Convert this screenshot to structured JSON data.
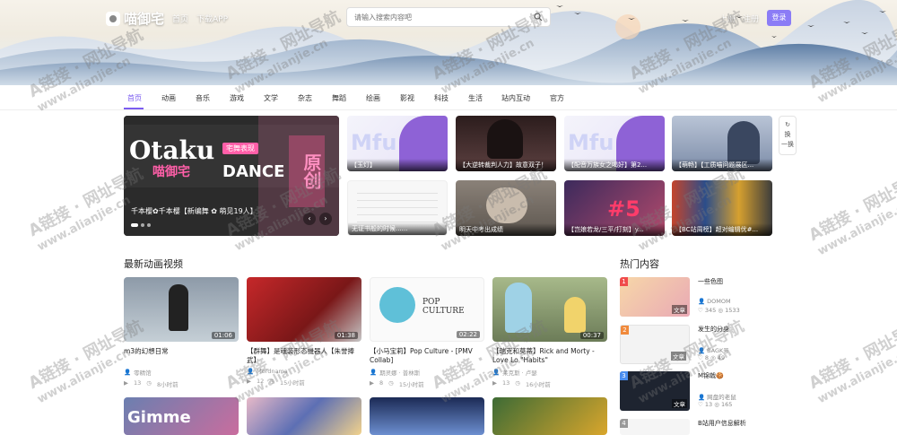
{
  "header": {
    "logo": "喵御宅",
    "nav": [
      "首页",
      "下载APP"
    ],
    "search_placeholder": "请输入搜索内容吧",
    "register": "上册",
    "sign_up": "注册",
    "login": "登录"
  },
  "categories": [
    "首页",
    "动画",
    "音乐",
    "游戏",
    "文学",
    "杂志",
    "舞蹈",
    "绘画",
    "影视",
    "科技",
    "生活",
    "站内互动",
    "官方"
  ],
  "active_category": "首页",
  "hero": {
    "t1": "Otaku",
    "t2": "喵御宅",
    "t3": "DANCE",
    "t4": "原创",
    "tag": "宅舞表现",
    "caption": "千本樱✿千本樱【新编舞 ✿ 萌见19人】"
  },
  "featured": [
    {
      "caption": "【玉灯】",
      "mfu": "Mfu"
    },
    {
      "caption": "【大逆转裁判人力】故意双子！"
    },
    {
      "caption": "【配音万族女之喝好】第2...",
      "mfu": "Mfu"
    },
    {
      "caption": "【萌畅】【工质喵问题展区..."
    },
    {
      "caption": "无证书般的时候......"
    },
    {
      "caption": "明天中考出成绩"
    },
    {
      "caption": "【岂娘若龙/三平/打刻】y...",
      "big": "#5"
    },
    {
      "caption": "【BC站周榜】超对编辑优#..."
    }
  ],
  "refresh": {
    "top": "换",
    "bottom": "一换"
  },
  "sections": {
    "latest": "最新动画视频",
    "hot": "热门内容"
  },
  "videos": [
    {
      "title": "m3的幻想日常",
      "duration": "01:06",
      "author": "零精馆",
      "views": "13",
      "time": "8小时前"
    },
    {
      "title": "【群舞】是魂装形态機器人【朱誉捧武】",
      "duration": "01:38",
      "author": "Mordnama",
      "views": "12",
      "time": "15小时前"
    },
    {
      "title": "【小马宝莉】Pop Culture - [PMV Collab]",
      "duration": "02:22",
      "author": "期灵娜 · 普林斯",
      "views": "8",
      "time": "15小时前"
    },
    {
      "title": "【瑞克和莫蒂】Rick and Morty - Love Lo \"Habits\"",
      "duration": "00:37",
      "author": "莱克斯 · 卢瑟",
      "views": "13",
      "time": "16小时前"
    }
  ],
  "bottom_cards": [
    "Gimme",
    "",
    "",
    "",
    ""
  ],
  "hot": [
    {
      "rank": "1",
      "title": "一些色图",
      "author": "DOMOM",
      "likes": "345",
      "views": "1533",
      "tag": "文章"
    },
    {
      "rank": "2",
      "title": "发生的分身",
      "author": "BAGK号",
      "likes": "8",
      "views": "49",
      "tag": "文章"
    },
    {
      "rank": "3",
      "title": "M锦戟🍪",
      "author": "网盘的老鼠",
      "likes": "13",
      "views": "165",
      "tag": "文章"
    },
    {
      "rank": "4",
      "title": "B站用户信息解析",
      "author": "",
      "likes": "",
      "views": "",
      "tag": ""
    }
  ],
  "watermark": {
    "line1": "A链接 · 网址导航",
    "line2": "www.alianjie.cn"
  },
  "colors": {
    "accent": "#7b5cf0",
    "login_bg": "#8b7cf6"
  }
}
